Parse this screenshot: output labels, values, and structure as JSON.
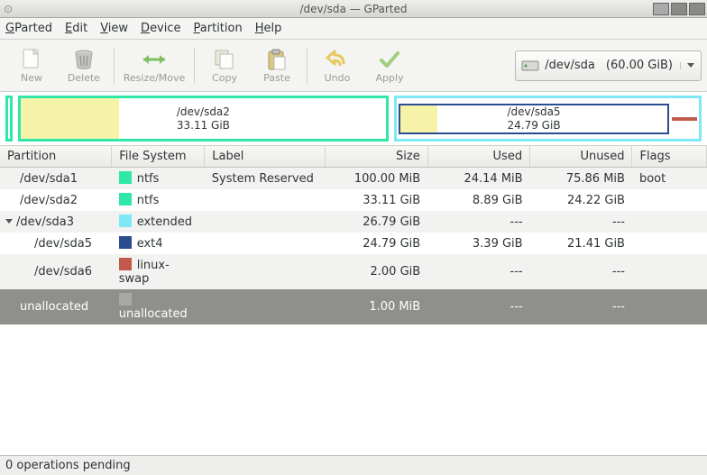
{
  "window": {
    "title": "/dev/sda — GParted"
  },
  "menu": {
    "gparted": "GParted",
    "edit": "Edit",
    "view": "View",
    "device": "Device",
    "partition": "Partition",
    "help": "Help"
  },
  "toolbar": {
    "new": "New",
    "delete": "Delete",
    "resize": "Resize/Move",
    "copy": "Copy",
    "paste": "Paste",
    "undo": "Undo",
    "apply": "Apply"
  },
  "device": {
    "path": "/dev/sda",
    "size": "(60.00 GiB)"
  },
  "graph": {
    "sda2": {
      "label": "/dev/sda2",
      "size": "33.11 GiB"
    },
    "sda5": {
      "label": "/dev/sda5",
      "size": "24.79 GiB"
    }
  },
  "columns": {
    "partition": "Partition",
    "filesystem": "File System",
    "label": "Label",
    "size": "Size",
    "used": "Used",
    "unused": "Unused",
    "flags": "Flags"
  },
  "colors": {
    "ntfs": "#2fe8a8",
    "extended": "#7fe8f7",
    "ext4": "#2a4d8f",
    "swap": "#c15a4a",
    "unalloc": "#a8a8a4"
  },
  "rows": [
    {
      "name": "/dev/sda1",
      "fs": "ntfs",
      "fscolor": "ntfs",
      "label": "System Reserved",
      "size": "100.00 MiB",
      "used": "24.14 MiB",
      "unused": "75.86 MiB",
      "flags": "boot",
      "indent": 1
    },
    {
      "name": "/dev/sda2",
      "fs": "ntfs",
      "fscolor": "ntfs",
      "label": "",
      "size": "33.11 GiB",
      "used": "8.89 GiB",
      "unused": "24.22 GiB",
      "flags": "",
      "indent": 1
    },
    {
      "name": "/dev/sda3",
      "fs": "extended",
      "fscolor": "extended",
      "label": "",
      "size": "26.79 GiB",
      "used": "---",
      "unused": "---",
      "flags": "",
      "indent": 1,
      "expander": true
    },
    {
      "name": "/dev/sda5",
      "fs": "ext4",
      "fscolor": "ext4",
      "label": "",
      "size": "24.79 GiB",
      "used": "3.39 GiB",
      "unused": "21.41 GiB",
      "flags": "",
      "indent": 2
    },
    {
      "name": "/dev/sda6",
      "fs": "linux-swap",
      "fscolor": "swap",
      "label": "",
      "size": "2.00 GiB",
      "used": "---",
      "unused": "---",
      "flags": "",
      "indent": 2
    },
    {
      "name": "unallocated",
      "fs": "unallocated",
      "fscolor": "unalloc",
      "label": "",
      "size": "1.00 MiB",
      "used": "---",
      "unused": "---",
      "flags": "",
      "indent": 1,
      "selected": true
    }
  ],
  "status": "0 operations pending"
}
